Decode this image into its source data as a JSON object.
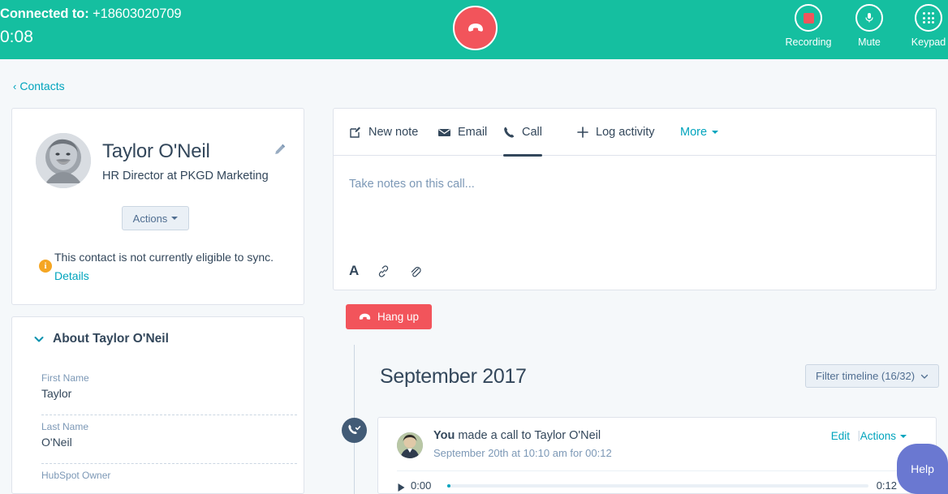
{
  "call_bar": {
    "connected_label": "Connected to:",
    "phone_number": "+18603020709",
    "timer": "0:08",
    "hangup_icon": "phone-hangup-icon",
    "controls": [
      {
        "id": "recording",
        "label": "Recording",
        "icon": "record-stop-icon"
      },
      {
        "id": "mute",
        "label": "Mute",
        "icon": "microphone-icon"
      },
      {
        "id": "keypad",
        "label": "Keypad",
        "icon": "keypad-grid-icon"
      }
    ],
    "background_color": "#15bfa0",
    "hangup_color": "#f2545b"
  },
  "breadcrumb": {
    "chevron": "‹",
    "label": "Contacts"
  },
  "contact": {
    "name": "Taylor O'Neil",
    "role": "HR Director at PKGD Marketing",
    "edit_icon": "pencil-icon",
    "avatar_icon": "contact-photo-avatar",
    "actions_label": "Actions",
    "sync_icon": "info-circle-icon",
    "sync_message": "This contact is not currently eligible to sync.",
    "sync_details_link": "Details"
  },
  "about": {
    "chevron_icon": "chevron-down-icon",
    "title": "About Taylor O'Neil",
    "fields": [
      {
        "label": "First Name",
        "value": "Taylor"
      },
      {
        "label": "Last Name",
        "value": "O'Neil"
      },
      {
        "label": "HubSpot Owner",
        "value": ""
      }
    ]
  },
  "compose": {
    "tabs": [
      {
        "id": "new-note",
        "label": "New note",
        "icon": "note-edit-icon",
        "active": false
      },
      {
        "id": "email",
        "label": "Email",
        "icon": "envelope-icon",
        "active": false
      },
      {
        "id": "call",
        "label": "Call",
        "icon": "phone-icon",
        "active": true
      },
      {
        "id": "log-activity",
        "label": "Log activity",
        "icon": "plus-icon",
        "active": false
      },
      {
        "id": "more",
        "label": "More",
        "icon": "caret-down-icon",
        "active": false
      }
    ],
    "note_placeholder": "Take notes on this call...",
    "editor_tools": [
      {
        "id": "font",
        "icon": "font-A-icon",
        "glyph": "A"
      },
      {
        "id": "link",
        "icon": "link-icon"
      },
      {
        "id": "attachment",
        "icon": "paperclip-icon"
      }
    ],
    "hangup_button": "Hang up"
  },
  "timeline": {
    "month_header": "September 2017",
    "filter_label": "Filter timeline (16/32)",
    "marker_icon": "phone-check-icon",
    "event": {
      "avatar_icon": "user-photo-avatar",
      "title_bold": "You",
      "title_rest": " made a call to Taylor O'Neil",
      "subtitle": "September 20th at 10:10 am for 00:12",
      "edit_label": "Edit",
      "separator": "|",
      "actions_label": "Actions",
      "player": {
        "play_icon": "play-triangle-icon",
        "time_start": "0:00",
        "time_end": "0:12",
        "trash_icon": "trash-icon",
        "progress_percent": 0
      }
    }
  },
  "help": {
    "label": "Help",
    "color": "#6a78d1"
  }
}
